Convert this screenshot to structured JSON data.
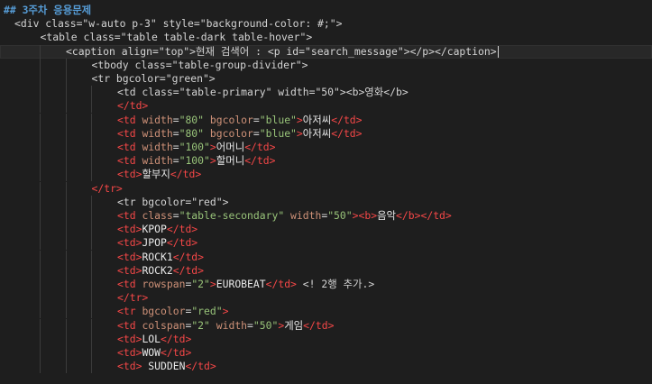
{
  "theme": {
    "background": "#1e1e1e",
    "current_line": "#282828",
    "heading": "#569cd6",
    "plain": "#d4d4d4",
    "tag": "#f44747",
    "attribute": "#ce9178",
    "string": "#98c379",
    "text": "#e8e8e8"
  },
  "editor": {
    "current_line": 3,
    "lines": [
      {
        "indent": 0,
        "segments": [
          {
            "t": "## 3주차 응용문제",
            "k": "md"
          }
        ]
      },
      {
        "indent": 0,
        "segments": [
          {
            "t": "<div class=\"w-auto p-3\" style=\"background-color: #;\">",
            "k": "pl"
          }
        ]
      },
      {
        "indent": 1,
        "segments": [
          {
            "t": "<table class=\"table table-dark table-hover\">",
            "k": "pl"
          }
        ]
      },
      {
        "indent": 2,
        "segments": [
          {
            "t": "<caption align=\"top\">현재 검색어 : <p id=\"search_message\"></p></caption>",
            "k": "pl"
          }
        ]
      },
      {
        "indent": 3,
        "segments": [
          {
            "t": "<tbody class=\"table-group-divider\">",
            "k": "pl"
          }
        ]
      },
      {
        "indent": 3,
        "segments": [
          {
            "t": "<tr bgcolor=\"green\">",
            "k": "pl"
          }
        ]
      },
      {
        "indent": 4,
        "segments": [
          {
            "t": "<td class=\"table-primary\" width=\"50\"><b>영화</b>",
            "k": "pl"
          }
        ]
      },
      {
        "indent": 4,
        "segments": [
          {
            "t": "</td>",
            "k": "tag"
          }
        ]
      },
      {
        "indent": 4,
        "segments": [
          {
            "t": "<td ",
            "k": "tag"
          },
          {
            "t": "width",
            "k": "attr"
          },
          {
            "t": "=",
            "k": "eq"
          },
          {
            "t": "\"80\"",
            "k": "str"
          },
          {
            "t": " ",
            "k": "pl"
          },
          {
            "t": "bgcolor",
            "k": "attr"
          },
          {
            "t": "=",
            "k": "eq"
          },
          {
            "t": "\"blue\"",
            "k": "str"
          },
          {
            "t": ">",
            "k": "tag"
          },
          {
            "t": "아저씨",
            "k": "txt"
          },
          {
            "t": "</td>",
            "k": "tag"
          }
        ]
      },
      {
        "indent": 4,
        "segments": [
          {
            "t": "<td ",
            "k": "tag"
          },
          {
            "t": "width",
            "k": "attr"
          },
          {
            "t": "=",
            "k": "eq"
          },
          {
            "t": "\"80\"",
            "k": "str"
          },
          {
            "t": " ",
            "k": "pl"
          },
          {
            "t": "bgcolor",
            "k": "attr"
          },
          {
            "t": "=",
            "k": "eq"
          },
          {
            "t": "\"blue\"",
            "k": "str"
          },
          {
            "t": ">",
            "k": "tag"
          },
          {
            "t": "아저씨",
            "k": "txt"
          },
          {
            "t": "</td>",
            "k": "tag"
          }
        ]
      },
      {
        "indent": 4,
        "segments": [
          {
            "t": "<td ",
            "k": "tag"
          },
          {
            "t": "width",
            "k": "attr"
          },
          {
            "t": "=",
            "k": "eq"
          },
          {
            "t": "\"100\"",
            "k": "str"
          },
          {
            "t": ">",
            "k": "tag"
          },
          {
            "t": "어머니",
            "k": "txt"
          },
          {
            "t": "</td>",
            "k": "tag"
          }
        ]
      },
      {
        "indent": 4,
        "segments": [
          {
            "t": "<td ",
            "k": "tag"
          },
          {
            "t": "width",
            "k": "attr"
          },
          {
            "t": "=",
            "k": "eq"
          },
          {
            "t": "\"100\"",
            "k": "str"
          },
          {
            "t": ">",
            "k": "tag"
          },
          {
            "t": "할머니",
            "k": "txt"
          },
          {
            "t": "</td>",
            "k": "tag"
          }
        ]
      },
      {
        "indent": 4,
        "segments": [
          {
            "t": "<td>",
            "k": "tag"
          },
          {
            "t": "할부지",
            "k": "txt"
          },
          {
            "t": "</td>",
            "k": "tag"
          }
        ]
      },
      {
        "indent": 3,
        "segments": [
          {
            "t": "</tr>",
            "k": "tag"
          }
        ]
      },
      {
        "indent": 4,
        "segments": [
          {
            "t": "<tr bgcolor=\"red\">",
            "k": "pl"
          }
        ]
      },
      {
        "indent": 4,
        "segments": [
          {
            "t": "<td ",
            "k": "tag"
          },
          {
            "t": "class",
            "k": "attr"
          },
          {
            "t": "=",
            "k": "eq"
          },
          {
            "t": "\"table-secondary\"",
            "k": "str"
          },
          {
            "t": " ",
            "k": "pl"
          },
          {
            "t": "width",
            "k": "attr"
          },
          {
            "t": "=",
            "k": "eq"
          },
          {
            "t": "\"50\"",
            "k": "str"
          },
          {
            "t": "><b>",
            "k": "tag"
          },
          {
            "t": "음악",
            "k": "txt"
          },
          {
            "t": "</b></td>",
            "k": "tag"
          }
        ]
      },
      {
        "indent": 4,
        "segments": [
          {
            "t": "<td>",
            "k": "tag"
          },
          {
            "t": "KPOP",
            "k": "txt"
          },
          {
            "t": "</td>",
            "k": "tag"
          }
        ]
      },
      {
        "indent": 4,
        "segments": [
          {
            "t": "<td>",
            "k": "tag"
          },
          {
            "t": "JPOP",
            "k": "txt"
          },
          {
            "t": "</td>",
            "k": "tag"
          }
        ]
      },
      {
        "indent": 4,
        "segments": [
          {
            "t": "<td>",
            "k": "tag"
          },
          {
            "t": "ROCK1",
            "k": "txt"
          },
          {
            "t": "</td>",
            "k": "tag"
          }
        ]
      },
      {
        "indent": 4,
        "segments": [
          {
            "t": "<td>",
            "k": "tag"
          },
          {
            "t": "ROCK2",
            "k": "txt"
          },
          {
            "t": "</td>",
            "k": "tag"
          }
        ]
      },
      {
        "indent": 4,
        "segments": [
          {
            "t": "<td ",
            "k": "tag"
          },
          {
            "t": "rowspan",
            "k": "attr"
          },
          {
            "t": "=",
            "k": "eq"
          },
          {
            "t": "\"2\"",
            "k": "str"
          },
          {
            "t": ">",
            "k": "tag"
          },
          {
            "t": "EUROBEAT",
            "k": "txt"
          },
          {
            "t": "</td>",
            "k": "tag"
          },
          {
            "t": " <! 2행 추가.>",
            "k": "pl"
          }
        ]
      },
      {
        "indent": 4,
        "segments": [
          {
            "t": "</tr>",
            "k": "tag"
          }
        ]
      },
      {
        "indent": 4,
        "segments": [
          {
            "t": "<tr ",
            "k": "tag"
          },
          {
            "t": "bgcolor",
            "k": "attr"
          },
          {
            "t": "=",
            "k": "eq"
          },
          {
            "t": "\"red\"",
            "k": "str"
          },
          {
            "t": ">",
            "k": "tag"
          }
        ]
      },
      {
        "indent": 4,
        "segments": [
          {
            "t": "<td ",
            "k": "tag"
          },
          {
            "t": "colspan",
            "k": "attr"
          },
          {
            "t": "=",
            "k": "eq"
          },
          {
            "t": "\"2\"",
            "k": "str"
          },
          {
            "t": " ",
            "k": "pl"
          },
          {
            "t": "width",
            "k": "attr"
          },
          {
            "t": "=",
            "k": "eq"
          },
          {
            "t": "\"50\"",
            "k": "str"
          },
          {
            "t": ">",
            "k": "tag"
          },
          {
            "t": "게임",
            "k": "txt"
          },
          {
            "t": "</td>",
            "k": "tag"
          }
        ]
      },
      {
        "indent": 4,
        "segments": [
          {
            "t": "<td>",
            "k": "tag"
          },
          {
            "t": "LOL",
            "k": "txt"
          },
          {
            "t": "</td>",
            "k": "tag"
          }
        ]
      },
      {
        "indent": 4,
        "segments": [
          {
            "t": "<td>",
            "k": "tag"
          },
          {
            "t": "WOW",
            "k": "txt"
          },
          {
            "t": "</td>",
            "k": "tag"
          }
        ]
      },
      {
        "indent": 4,
        "segments": [
          {
            "t": "<td>",
            "k": "tag"
          },
          {
            "t": " SUDDEN",
            "k": "txt"
          },
          {
            "t": "</td>",
            "k": "tag"
          }
        ]
      }
    ]
  }
}
